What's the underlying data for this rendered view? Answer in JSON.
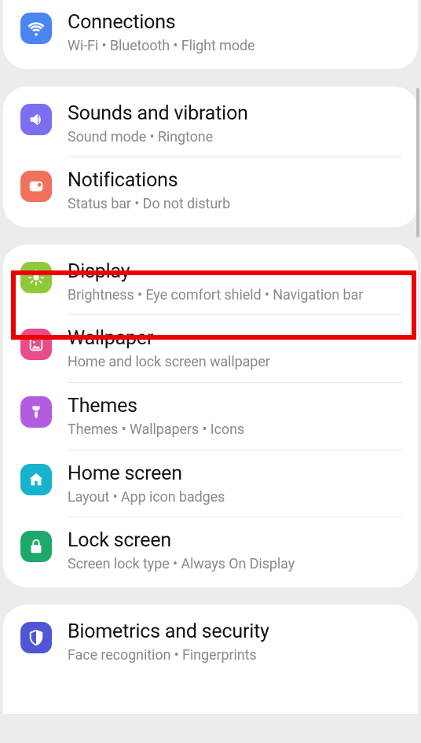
{
  "colors": {
    "connections": "#4a86f2",
    "sounds": "#7b6ef0",
    "notifications": "#ef725e",
    "display": "#8fc93a",
    "wallpaper": "#ea4c89",
    "themes": "#b25de0",
    "home": "#17b2cc",
    "lock": "#1fa86b",
    "biometrics": "#5056d6"
  },
  "groups": [
    {
      "items": [
        {
          "key": "connections",
          "title": "Connections",
          "subtitle": "Wi-Fi  •  Bluetooth  •  Flight mode",
          "icon": "wifi-icon"
        }
      ]
    },
    {
      "items": [
        {
          "key": "sounds",
          "title": "Sounds and vibration",
          "subtitle": "Sound mode  •  Ringtone",
          "icon": "speaker-icon"
        },
        {
          "key": "notifications",
          "title": "Notifications",
          "subtitle": "Status bar  •  Do not disturb",
          "icon": "notification-icon"
        }
      ]
    },
    {
      "items": [
        {
          "key": "display",
          "title": "Display",
          "subtitle": "Brightness  •  Eye comfort shield  •  Navigation bar",
          "icon": "brightness-icon",
          "highlighted": true
        },
        {
          "key": "wallpaper",
          "title": "Wallpaper",
          "subtitle": "Home and lock screen wallpaper",
          "icon": "wallpaper-icon"
        },
        {
          "key": "themes",
          "title": "Themes",
          "subtitle": "Themes  •  Wallpapers  •  Icons",
          "icon": "themes-icon"
        },
        {
          "key": "home",
          "title": "Home screen",
          "subtitle": "Layout  •  App icon badges",
          "icon": "home-icon"
        },
        {
          "key": "lock",
          "title": "Lock screen",
          "subtitle": "Screen lock type  •  Always On Display",
          "icon": "lock-icon"
        }
      ]
    },
    {
      "items": [
        {
          "key": "biometrics",
          "title": "Biometrics and security",
          "subtitle": "Face recognition  •  Fingerprints",
          "icon": "shield-icon"
        }
      ]
    }
  ]
}
